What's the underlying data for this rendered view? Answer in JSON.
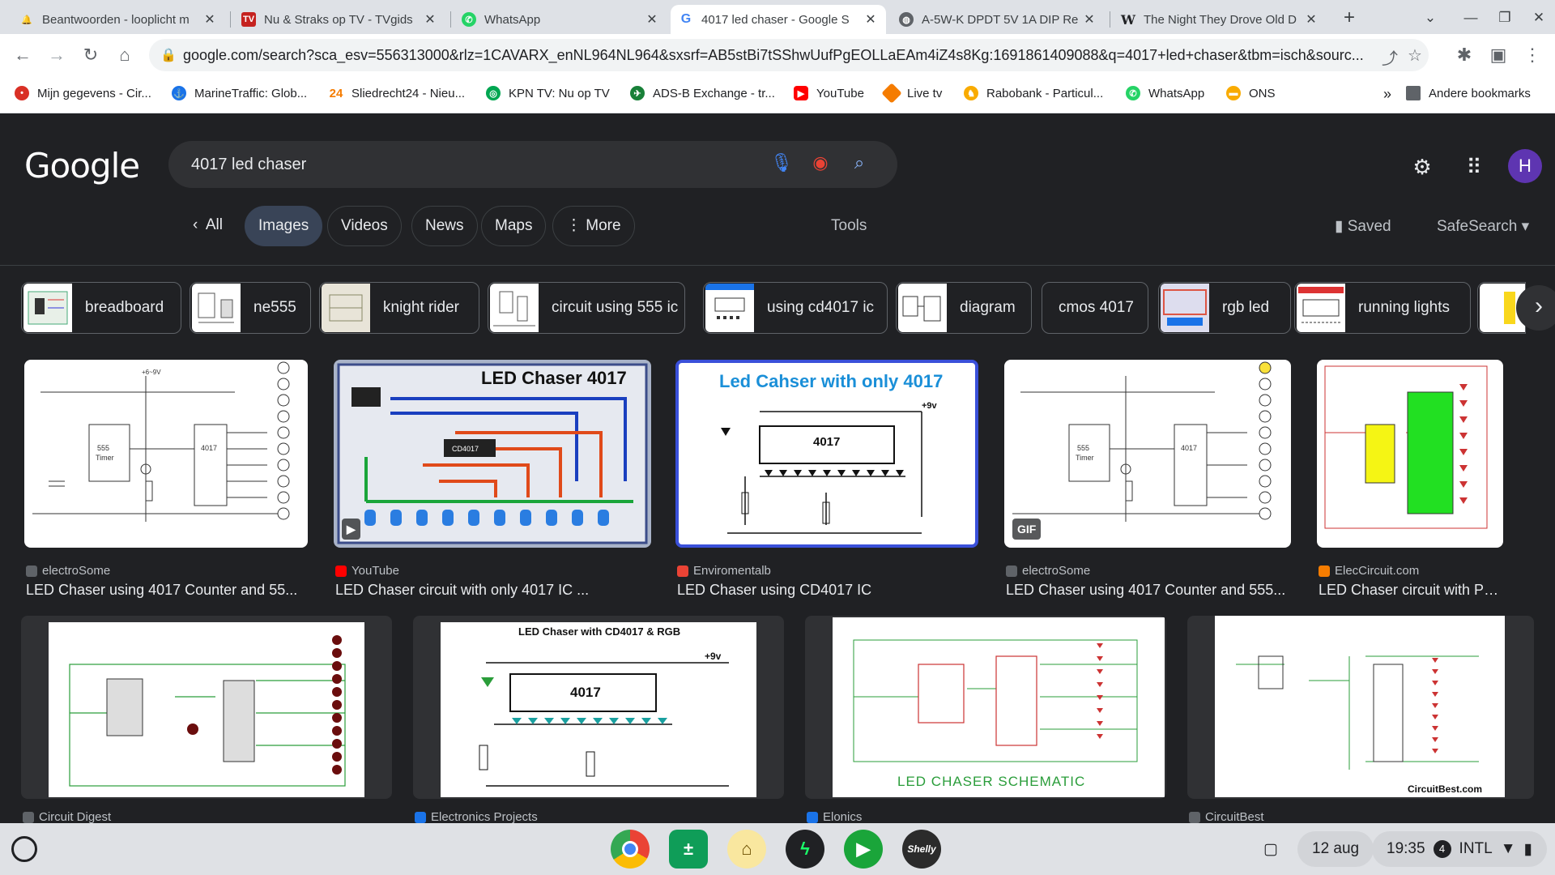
{
  "tabs": [
    {
      "title": "Beantwoorden - looplicht m",
      "fav": "bell-icon",
      "color": "#d93025"
    },
    {
      "title": "Nu & Straks op TV - TVgids",
      "fav": "tv-icon",
      "color": "#c5221f"
    },
    {
      "title": "WhatsApp",
      "fav": "whatsapp-icon",
      "color": "#25d366"
    },
    {
      "title": "4017 led chaser - Google S",
      "fav": "google-icon",
      "color": "#4285f4"
    },
    {
      "title": "A-5W-K DPDT 5V 1A DIP Re",
      "fav": "globe-icon",
      "color": "#5f6368"
    },
    {
      "title": "The Night They Drove Old D",
      "fav": "wikipedia-icon",
      "color": "#202124"
    }
  ],
  "url": "google.com/search?sca_esv=556313000&rlz=1CAVARX_enNL964NL964&sxsrf=AB5stBi7tSShwUufPgEOLLaEAm4iZ4s8Kg:1691861409088&q=4017+led+chaser&tbm=isch&sourc...",
  "bookmarks": [
    {
      "label": "Mijn gegevens - Cir...",
      "color": "#d93025"
    },
    {
      "label": "MarineTraffic: Glob...",
      "color": "#1a73e8"
    },
    {
      "label": "Sliedrecht24 - Nieu...",
      "color": "#f9ab00"
    },
    {
      "label": "KPN TV: Nu op TV",
      "color": "#00a651"
    },
    {
      "label": "ADS-B Exchange - tr...",
      "color": "#188038"
    },
    {
      "label": "YouTube",
      "color": "#ff0000"
    },
    {
      "label": "Live tv",
      "color": "#f57c00"
    },
    {
      "label": "Rabobank - Particul...",
      "color": "#f9ab00"
    },
    {
      "label": "WhatsApp",
      "color": "#25d366"
    },
    {
      "label": "ONS",
      "color": "#f9ab00"
    }
  ],
  "bookmarks_more": "»",
  "other_bookmarks": "Andere bookmarks",
  "google_logo": "Google",
  "search_query": "4017 led chaser",
  "nav": {
    "all": "All",
    "images": "Images",
    "videos": "Videos",
    "news": "News",
    "maps": "Maps",
    "more": "More",
    "tools": "Tools",
    "saved": "Saved",
    "safesearch": "SafeSearch"
  },
  "avatar_letter": "H",
  "related": [
    "breadboard",
    "ne555",
    "knight rider",
    "circuit using 555 ic",
    "using cd4017 ic",
    "diagram",
    "cmos 4017",
    "rgb led",
    "running lights"
  ],
  "results_row1": [
    {
      "source": "electroSome",
      "title": "LED Chaser using 4017 Counter and 55...",
      "src_color": "#5f6368"
    },
    {
      "source": "YouTube",
      "title": "LED Chaser circuit with only 4017 IC ...",
      "src_color": "#ff0000",
      "badge": "▶",
      "img_title": "LED Chaser 4017"
    },
    {
      "source": "Enviromentalb",
      "title": "LED Chaser using CD4017 IC",
      "src_color": "#ea4335",
      "img_title": "Led Cahser with only 4017"
    },
    {
      "source": "electroSome",
      "title": "LED Chaser using 4017 Counter and 555...",
      "src_color": "#5f6368",
      "badge": "GIF"
    },
    {
      "source": "ElecCircuit.com",
      "title": "LED Chaser circuit with PCB l...",
      "src_color": "#f57c00"
    }
  ],
  "results_row2": [
    {
      "source": "Circuit Digest",
      "src_color": "#5f6368"
    },
    {
      "source": "Electronics Projects",
      "src_color": "#1a73e8",
      "img_title": "LED Chaser with CD4017 & RGB"
    },
    {
      "source": "Elonics",
      "src_color": "#1a73e8",
      "img_title": "LED CHASER SCHEMATIC"
    },
    {
      "source": "CircuitBest",
      "src_color": "#5f6368",
      "img_title": "CircuitBest.com"
    }
  ],
  "shelf": {
    "date": "12 aug",
    "time": "19:35",
    "notif_count": "4",
    "keyboard": "INTL"
  }
}
